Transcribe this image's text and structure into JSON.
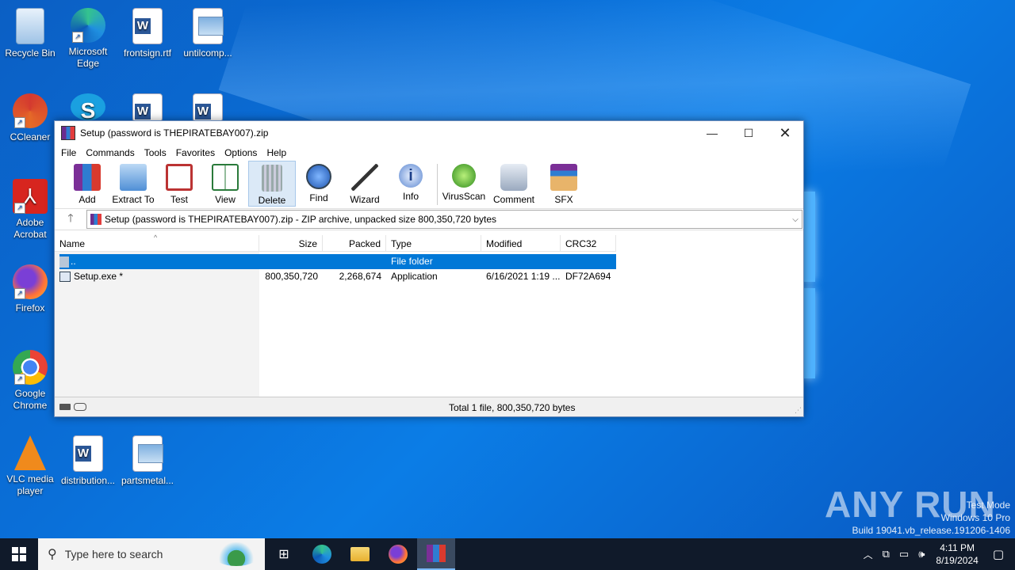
{
  "desktop": {
    "icons": [
      {
        "label": "Recycle Bin",
        "icon": "recycle-bin-icon"
      },
      {
        "label": "Microsoft Edge",
        "icon": "edge-icon"
      },
      {
        "label": "frontsign.rtf",
        "icon": "word-doc-icon"
      },
      {
        "label": "untilcomp...",
        "icon": "image-file-icon"
      },
      {
        "label": "CCleaner",
        "icon": "ccleaner-icon"
      },
      {
        "label": "Adobe Acrobat",
        "icon": "acrobat-icon"
      },
      {
        "label": "Firefox",
        "icon": "firefox-icon"
      },
      {
        "label": "Google Chrome",
        "icon": "chrome-icon"
      },
      {
        "label": "VLC media player",
        "icon": "vlc-icon"
      },
      {
        "label": "distribution...",
        "icon": "word-doc-icon"
      },
      {
        "label": "partsmetal...",
        "icon": "image-file-icon"
      }
    ]
  },
  "window": {
    "title": "Setup (password is THEPIRATEBAY007).zip",
    "menu": [
      "File",
      "Commands",
      "Tools",
      "Favorites",
      "Options",
      "Help"
    ],
    "toolbar": [
      {
        "label": "Add",
        "icon": "add-archive-icon"
      },
      {
        "label": "Extract To",
        "icon": "extract-folder-icon"
      },
      {
        "label": "Test",
        "icon": "test-clipboard-icon"
      },
      {
        "label": "View",
        "icon": "view-book-icon"
      },
      {
        "label": "Delete",
        "icon": "trash-icon"
      },
      {
        "label": "Find",
        "icon": "magnifier-icon"
      },
      {
        "label": "Wizard",
        "icon": "wand-icon"
      },
      {
        "label": "Info",
        "icon": "info-icon"
      },
      {
        "label": "VirusScan",
        "icon": "virus-scan-icon"
      },
      {
        "label": "Comment",
        "icon": "comment-icon"
      },
      {
        "label": "SFX",
        "icon": "sfx-box-icon"
      }
    ],
    "address": "Setup (password is THEPIRATEBAY007).zip - ZIP archive, unpacked size 800,350,720 bytes",
    "columns": [
      "Name",
      "Size",
      "Packed",
      "Type",
      "Modified",
      "CRC32"
    ],
    "rows": [
      {
        "name": "..",
        "size": "",
        "packed": "",
        "type": "File folder",
        "modified": "",
        "crc": ""
      },
      {
        "name": "Setup.exe *",
        "size": "800,350,720",
        "packed": "2,268,674",
        "type": "Application",
        "modified": "6/16/2021 1:19 ...",
        "crc": "DF72A694"
      }
    ],
    "status": "Total 1 file, 800,350,720 bytes"
  },
  "taskbar": {
    "search_placeholder": "Type here to search",
    "time": "4:11 PM",
    "date": "8/19/2024"
  },
  "watermark": {
    "line1": "Test Mode",
    "line2": "Windows 10 Pro",
    "line3": "Build 19041.vb_release.191206-1406",
    "brand": "ANY RUN"
  },
  "colors": {
    "selection": "#0078d7",
    "desktop": "#0a6fd8",
    "taskbar": "#101a2a"
  }
}
